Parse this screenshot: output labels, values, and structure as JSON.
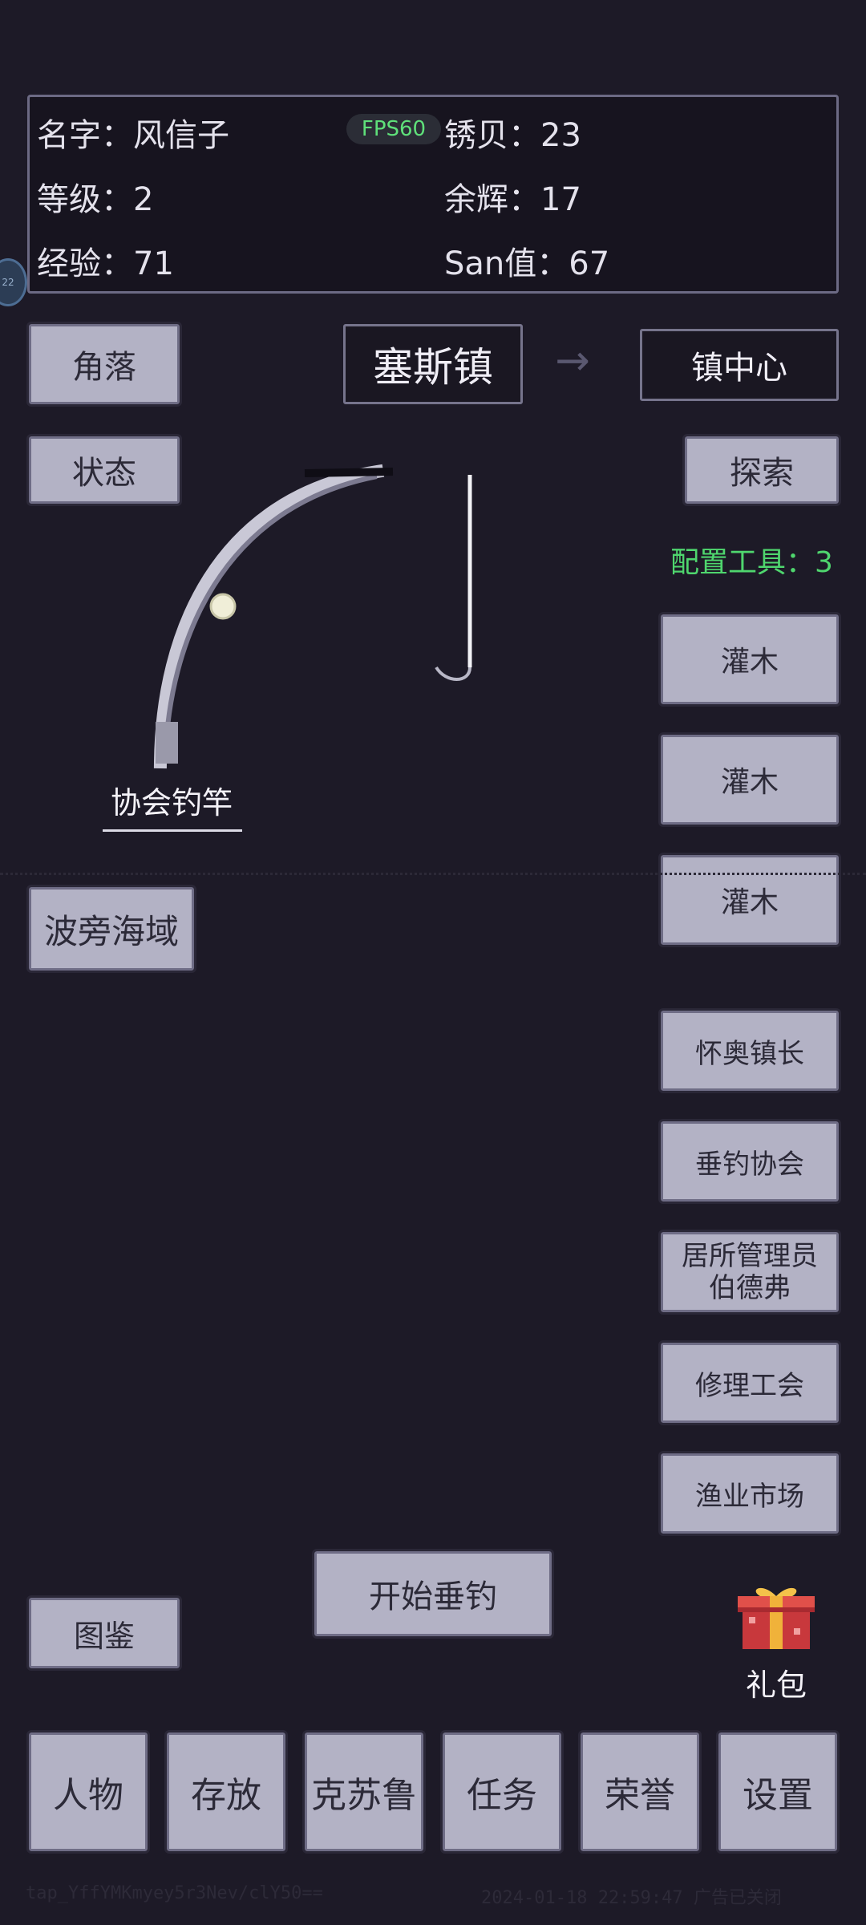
{
  "stats": {
    "name_label": "名字：风信子",
    "level_label": "等级：2",
    "exp_label": "经验：71",
    "rust_shell_label": "锈贝：23",
    "afterglow_label": "余辉：17",
    "san_label": "San值：67",
    "fps_badge": "FPS60"
  },
  "floating_badge": "22",
  "nav": {
    "corner_button": "角落",
    "status_button": "状态",
    "town_title": "塞斯镇",
    "arrow": "→",
    "destination_button": "镇中心",
    "explore_button": "探索"
  },
  "gear": {
    "count_label": "配置工具：3",
    "slots": [
      "灌木",
      "灌木",
      "灌木"
    ]
  },
  "rod": {
    "name": "协会钓竿"
  },
  "sea_button": "波旁海域",
  "npcs": [
    "怀奥镇长",
    "垂钓协会",
    "居所管理员\n伯德弗",
    "修理工会",
    "渔业市场"
  ],
  "start_fishing_button": "开始垂钓",
  "codex_button": "图鉴",
  "gift": {
    "label": "礼包",
    "icon": "gift-box-icon"
  },
  "tabs": [
    "人物",
    "存放",
    "克苏鲁",
    "任务",
    "荣誉",
    "设置"
  ],
  "footer": {
    "watermark_left": "tap_YffYMKmyey5r3Nev/clY50==",
    "watermark_right": "2024-01-18 22:59:47 广告已关闭"
  },
  "colors": {
    "background": "#1d1a27",
    "button": "#b3b2c5",
    "accent_green": "#4fd66e"
  }
}
